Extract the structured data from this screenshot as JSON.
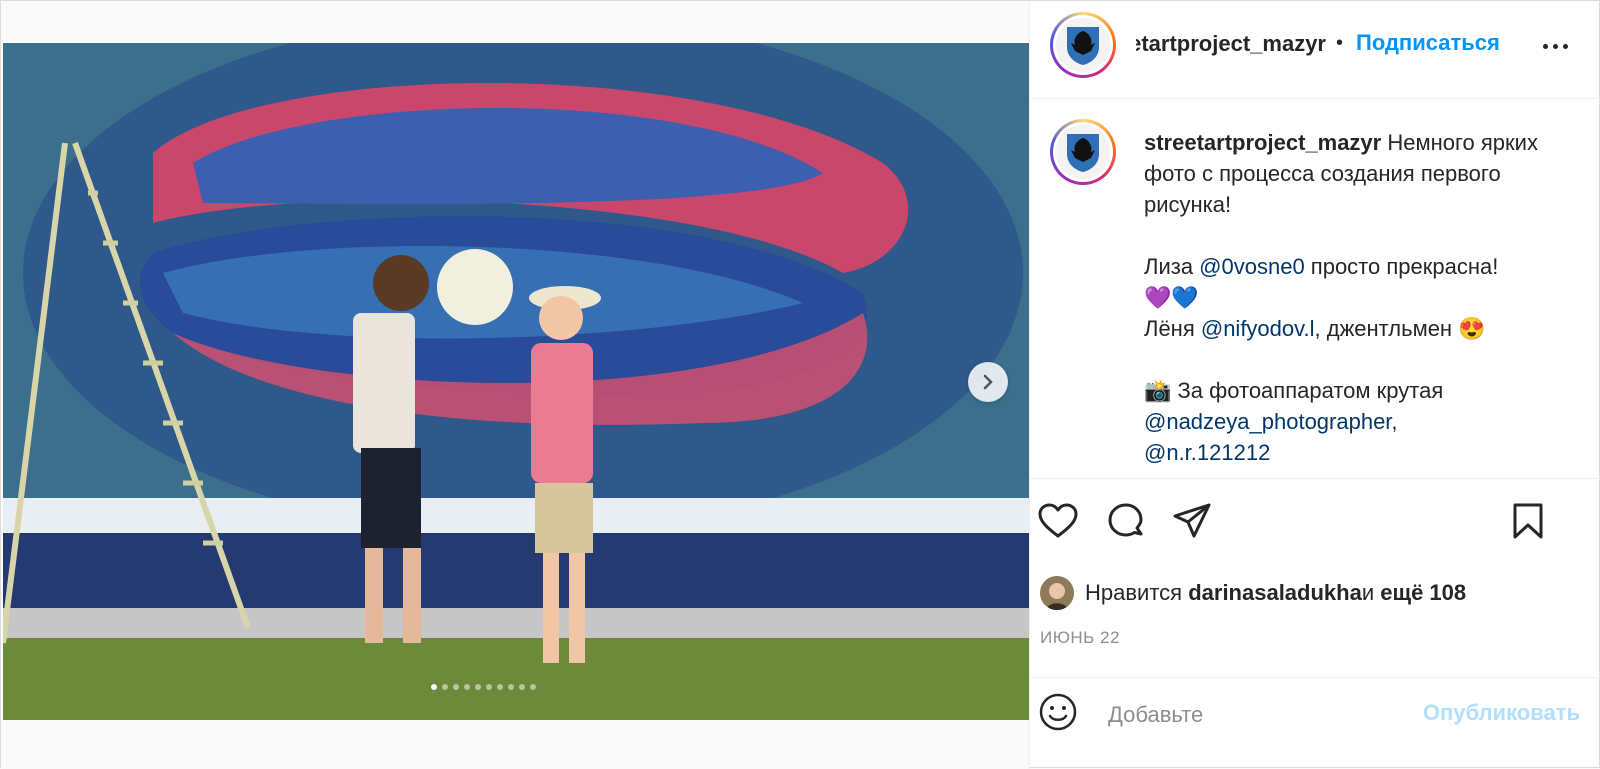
{
  "header": {
    "username": "streetartproject_mazyr",
    "separator": "•",
    "follow_label": "Подписаться",
    "more_icon": "more-horizontal-icon"
  },
  "caption": {
    "username": "streetartproject_mazyr",
    "line1": "Немного ярких фото с процесса создания первого рисунка!",
    "line2_prefix": "Лиза ",
    "line2_mention": "@0vosne0",
    "line2_suffix": " просто прекрасна!",
    "line3_emoji": "💜💙",
    "line4_prefix": "Лёня ",
    "line4_mention": "@nifyodov.l",
    "line4_suffix": ", джентльмен 😍",
    "line5_prefix": "📸 За фотоаппаратом крутая ",
    "line5_mention": "@nadzeya_photographer",
    "line5_comma": ",",
    "line6_mention": "@n.r.121212"
  },
  "actions": {
    "like_icon": "heart-icon",
    "comment_icon": "comment-icon",
    "share_icon": "share-icon",
    "save_icon": "bookmark-icon"
  },
  "likes": {
    "prefix": "Нравится ",
    "user": "darinasaladukha",
    "middle": " и ",
    "others": "ещё 108"
  },
  "date": "ИЮНЬ 22",
  "comment": {
    "placeholder": "Добавьте",
    "post_label": "Опубликовать"
  },
  "carousel": {
    "total": 10,
    "current": 1
  },
  "colors": {
    "accent": "#0095f6",
    "mention": "#00376b",
    "muted": "#8e8e8e",
    "post_disabled": "#b2dffc"
  }
}
